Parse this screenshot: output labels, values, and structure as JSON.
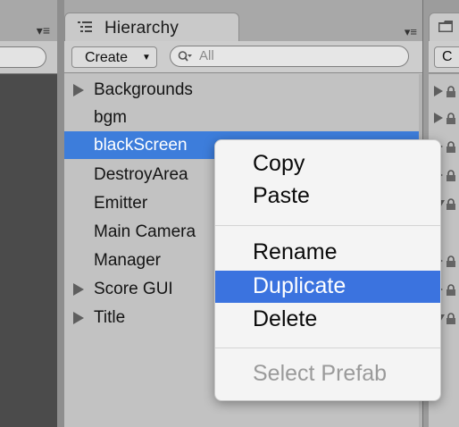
{
  "hierarchy": {
    "tab_title": "Hierarchy",
    "create_label": "Create",
    "search_placeholder": "All",
    "items": [
      {
        "label": "Backgrounds",
        "foldout": true
      },
      {
        "label": "bgm",
        "foldout": false
      },
      {
        "label": "blackScreen",
        "foldout": false,
        "selected": true
      },
      {
        "label": "DestroyArea",
        "foldout": false
      },
      {
        "label": "Emitter",
        "foldout": false
      },
      {
        "label": "Main Camera",
        "foldout": false
      },
      {
        "label": "Manager",
        "foldout": false
      },
      {
        "label": "Score GUI",
        "foldout": true
      },
      {
        "label": "Title",
        "foldout": true
      }
    ]
  },
  "right_panel": {
    "button_label": "C"
  },
  "context_menu": {
    "items": [
      {
        "label": "Copy"
      },
      {
        "label": "Paste"
      },
      {
        "label": "Rename"
      },
      {
        "label": "Duplicate",
        "highlighted": true
      },
      {
        "label": "Delete"
      },
      {
        "label": "Select Prefab",
        "disabled": true
      }
    ]
  },
  "colors": {
    "selection": "#3d7ddb",
    "menu_highlight": "#3b73df",
    "panel_bg": "#c2c2c2"
  }
}
